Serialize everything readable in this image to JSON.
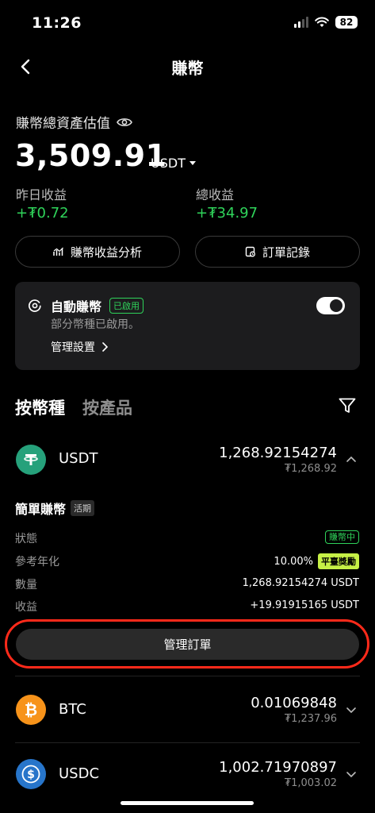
{
  "status_bar": {
    "time": "11:26",
    "battery": "82"
  },
  "nav": {
    "title": "賺幣"
  },
  "asset": {
    "label": "賺幣總資產估值",
    "value": "3,509.91",
    "unit": "USDT",
    "yesterday_label": "昨日收益",
    "yesterday_value": "+₮0.72",
    "total_label": "總收益",
    "total_value": "+₮34.97"
  },
  "actions": {
    "analysis": "賺幣收益分析",
    "orders": "訂單記錄"
  },
  "auto_earn": {
    "title": "自動賺幣",
    "badge": "已啟用",
    "subtitle": "部分幣種已啟用。",
    "manage": "管理設置",
    "enabled": true
  },
  "tabs": [
    {
      "label": "按幣種"
    },
    {
      "label": "按產品"
    }
  ],
  "coins": [
    {
      "name": "USDT",
      "amount": "1,268.92154274",
      "fiat": "₮1,268.92",
      "color": "#26a17b"
    },
    {
      "name": "BTC",
      "amount": "0.01069848",
      "fiat": "₮1,237.96",
      "color": "#f7931a"
    },
    {
      "name": "USDC",
      "amount": "1,002.71970897",
      "fiat": "₮1,003.02",
      "color": "#2775ca"
    }
  ],
  "simple_earn": {
    "title": "簡單賺幣",
    "tag": "活期",
    "rows": {
      "status_label": "狀態",
      "status_value": "賺幣中",
      "apr_label": "參考年化",
      "apr_value": "10.00%",
      "apr_badge": "平臺獎勵",
      "qty_label": "數量",
      "qty_value": "1,268.92154274 USDT",
      "earn_label": "收益",
      "earn_value": "+19.91915165 USDT"
    },
    "manage_order": "管理訂單"
  },
  "colors": {
    "green": "#2fd35a",
    "highlight": "#ff2a1a",
    "reward": "#c6f046"
  }
}
